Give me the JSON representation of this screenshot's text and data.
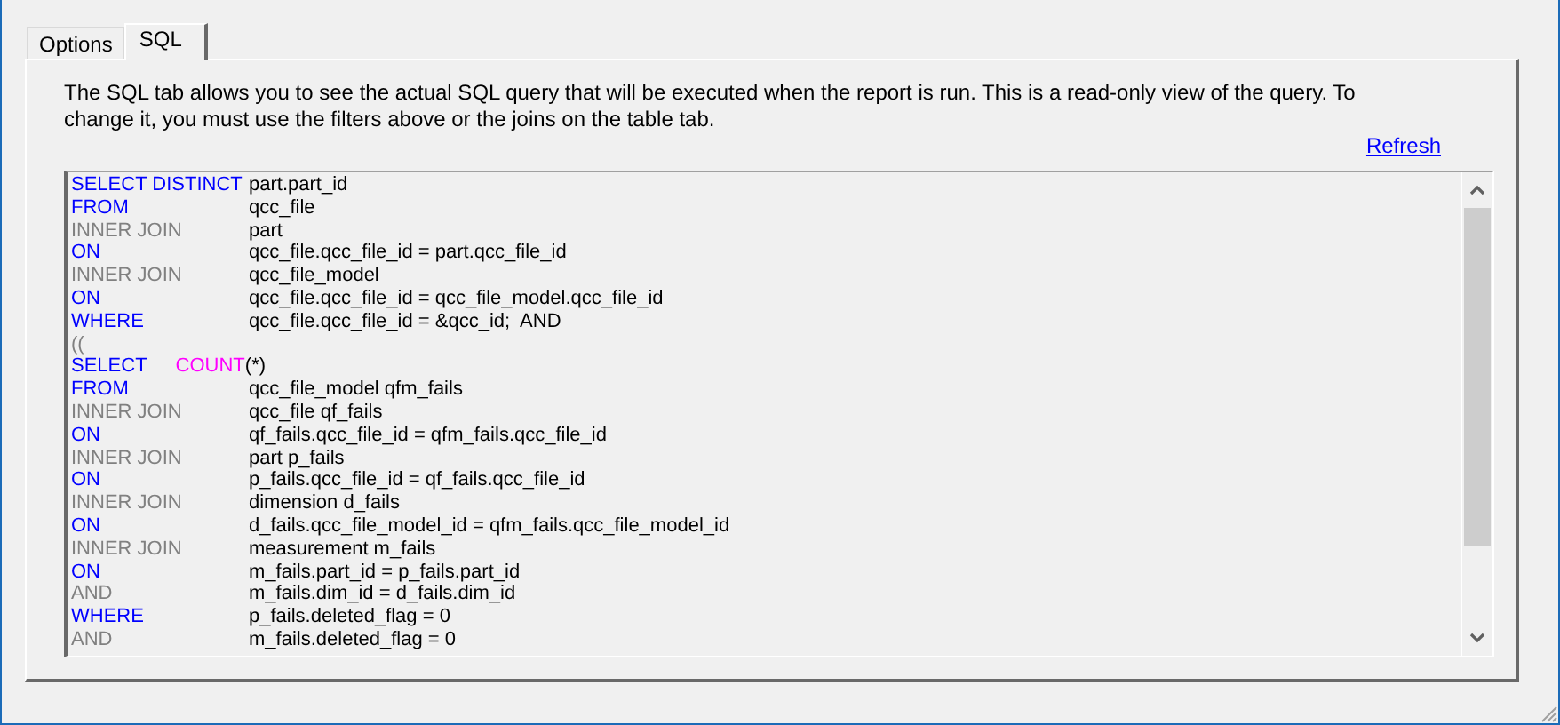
{
  "tabs": [
    {
      "label": "Options",
      "selected": false
    },
    {
      "label": "SQL",
      "selected": true
    }
  ],
  "description": "The SQL tab allows you to see the actual SQL query that will be executed when the report is run. This is a read-only view of the query. To change it, you must use the filters above or the joins on the table tab.",
  "refresh_link": "Refresh",
  "sql_lines": [
    {
      "keyword": "SELECT DISTINCT",
      "kind": "clause",
      "text": "part.part_id"
    },
    {
      "keyword": "FROM",
      "kind": "clause",
      "text": "qcc_file"
    },
    {
      "keyword": "INNER JOIN",
      "kind": "join",
      "text": "part"
    },
    {
      "keyword": "ON",
      "kind": "clause",
      "text": "qcc_file.qcc_file_id = part.qcc_file_id"
    },
    {
      "keyword": "INNER JOIN",
      "kind": "join",
      "text": "qcc_file_model"
    },
    {
      "keyword": "ON",
      "kind": "clause",
      "text": "qcc_file.qcc_file_id = qcc_file_model.qcc_file_id"
    },
    {
      "keyword": "WHERE",
      "kind": "clause",
      "text": "qcc_file.qcc_file_id = &qcc_id;  AND"
    },
    {
      "keyword": "((",
      "kind": "paren"
    },
    {
      "keyword": "SELECT",
      "kind": "clause",
      "function": "COUNT",
      "text": "(*)"
    },
    {
      "keyword": "FROM",
      "kind": "clause",
      "text": "qcc_file_model qfm_fails"
    },
    {
      "keyword": "INNER JOIN",
      "kind": "join",
      "text": "qcc_file qf_fails"
    },
    {
      "keyword": "ON",
      "kind": "clause",
      "text": "qf_fails.qcc_file_id = qfm_fails.qcc_file_id"
    },
    {
      "keyword": "INNER JOIN",
      "kind": "join",
      "text": "part p_fails"
    },
    {
      "keyword": "ON",
      "kind": "clause",
      "text": "p_fails.qcc_file_id = qf_fails.qcc_file_id"
    },
    {
      "keyword": "INNER JOIN",
      "kind": "join",
      "text": "dimension d_fails"
    },
    {
      "keyword": "ON",
      "kind": "clause",
      "text": "d_fails.qcc_file_model_id = qfm_fails.qcc_file_model_id"
    },
    {
      "keyword": "INNER JOIN",
      "kind": "join",
      "text": "measurement m_fails"
    },
    {
      "keyword": "ON",
      "kind": "clause",
      "text": "m_fails.part_id = p_fails.part_id"
    },
    {
      "keyword": "AND",
      "kind": "join",
      "text": "m_fails.dim_id = d_fails.dim_id"
    },
    {
      "keyword": "WHERE",
      "kind": "clause",
      "text": "p_fails.deleted_flag = 0"
    },
    {
      "keyword": "AND",
      "kind": "join",
      "text": "m_fails.deleted_flag = 0"
    }
  ]
}
